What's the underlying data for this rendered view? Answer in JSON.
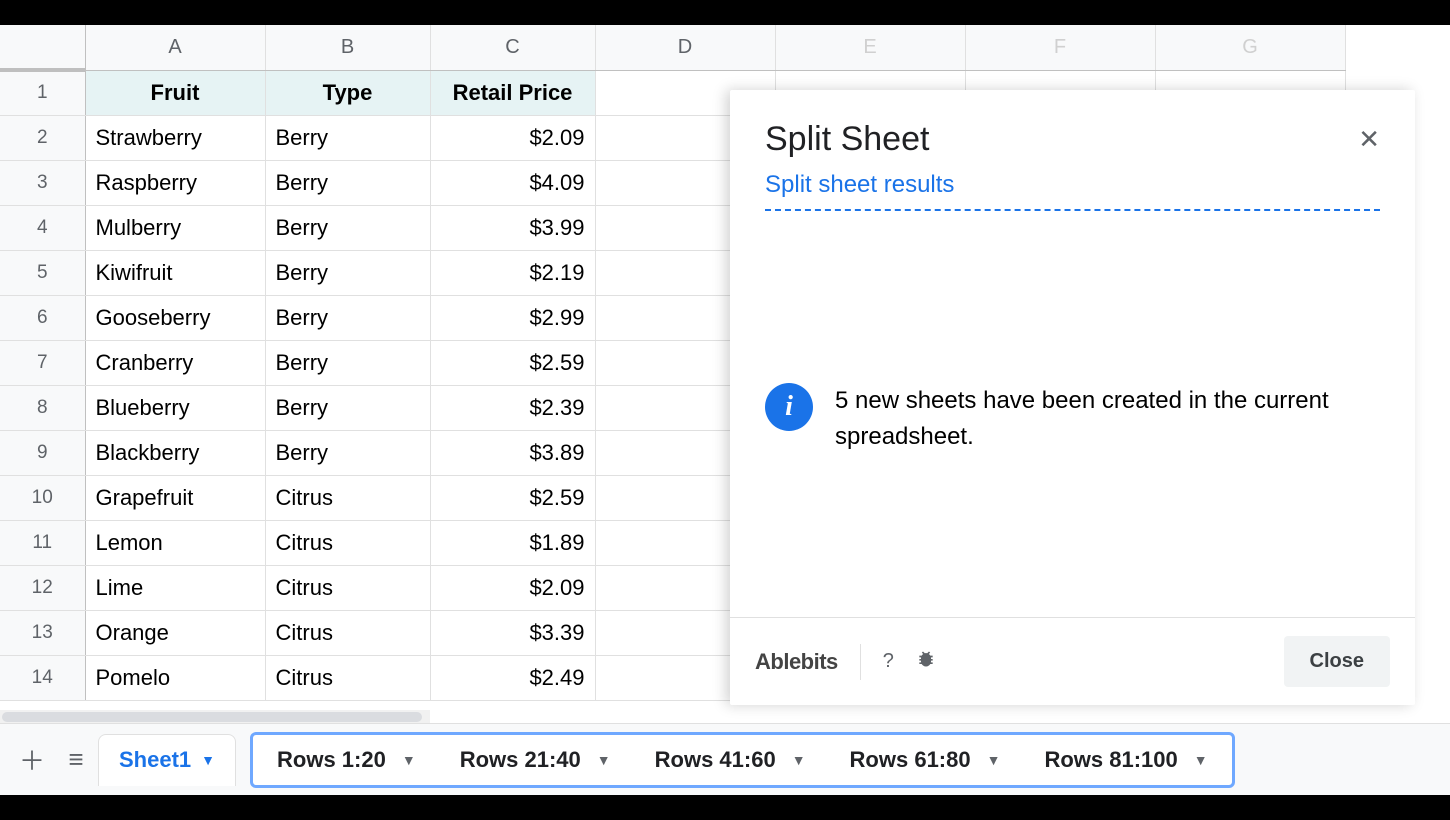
{
  "columns": [
    "A",
    "B",
    "C",
    "D",
    "E",
    "F",
    "G"
  ],
  "dim_columns": [
    "E",
    "F",
    "G"
  ],
  "column_widths": {
    "A": "col-A",
    "B": "col-B",
    "C": "col-C",
    "D": "col-D",
    "E": "col-E",
    "F": "col-F",
    "G": "col-G"
  },
  "header_row": {
    "fruit": "Fruit",
    "type": "Type",
    "price": "Retail Price"
  },
  "rows": [
    {
      "n": 1,
      "fruit": "Fruit",
      "type": "Type",
      "price": "Retail Price",
      "is_header": true
    },
    {
      "n": 2,
      "fruit": "Strawberry",
      "type": "Berry",
      "price": "$2.09"
    },
    {
      "n": 3,
      "fruit": "Raspberry",
      "type": "Berry",
      "price": "$4.09"
    },
    {
      "n": 4,
      "fruit": "Mulberry",
      "type": "Berry",
      "price": "$3.99"
    },
    {
      "n": 5,
      "fruit": "Kiwifruit",
      "type": "Berry",
      "price": "$2.19"
    },
    {
      "n": 6,
      "fruit": "Gooseberry",
      "type": "Berry",
      "price": "$2.99"
    },
    {
      "n": 7,
      "fruit": "Cranberry",
      "type": "Berry",
      "price": "$2.59"
    },
    {
      "n": 8,
      "fruit": "Blueberry",
      "type": "Berry",
      "price": "$2.39"
    },
    {
      "n": 9,
      "fruit": "Blackberry",
      "type": "Berry",
      "price": "$3.89"
    },
    {
      "n": 10,
      "fruit": "Grapefruit",
      "type": "Citrus",
      "price": "$2.59"
    },
    {
      "n": 11,
      "fruit": "Lemon",
      "type": "Citrus",
      "price": "$1.89"
    },
    {
      "n": 12,
      "fruit": "Lime",
      "type": "Citrus",
      "price": "$2.09"
    },
    {
      "n": 13,
      "fruit": "Orange",
      "type": "Citrus",
      "price": "$3.39"
    },
    {
      "n": 14,
      "fruit": "Pomelo",
      "type": "Citrus",
      "price": "$2.49"
    }
  ],
  "panel": {
    "title": "Split Sheet",
    "subtitle": "Split sheet results",
    "message": "5 new sheets have been created in the current spreadsheet.",
    "brand": "Ablebits",
    "help": "?",
    "close_label": "Close"
  },
  "tabs": {
    "active": "Sheet1",
    "new_tabs": [
      "Rows 1:20",
      "Rows 21:40",
      "Rows 41:60",
      "Rows 61:80",
      "Rows 81:100"
    ]
  }
}
